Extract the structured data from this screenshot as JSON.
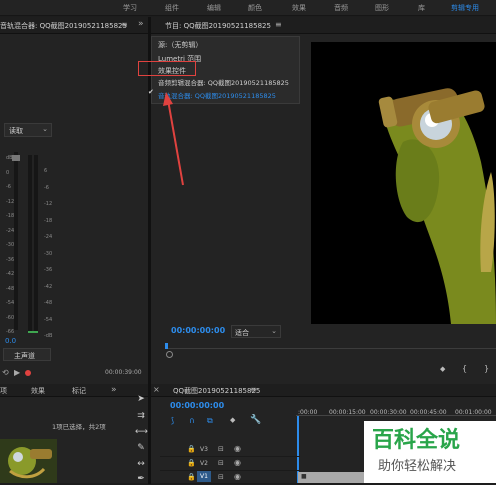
{
  "workspace_tabs": [
    "学习",
    "组件",
    "编辑",
    "颜色",
    "效果",
    "音频",
    "图形",
    "库",
    "剪辑专用"
  ],
  "active_workspace": "剪辑专用",
  "mixer": {
    "panel_title": "音轨混合器: QQ截图20190521185825",
    "read_mode": "读取",
    "db_scale": [
      "dB",
      "0",
      "-6",
      "-12",
      "-18",
      "-24",
      "-30",
      "-36",
      "-42",
      "-48",
      "-54",
      "-60",
      "-66"
    ],
    "db_scale_right": [
      "6",
      "-6",
      "-12",
      "-18",
      "-24",
      "-30",
      "-36",
      "-42",
      "-48",
      "-54",
      "-dB"
    ],
    "zero_value": "0.0",
    "master_label": "主声道",
    "timecode": "00:00:39:00"
  },
  "program": {
    "panel_title": "节目: QQ截图20190521185825",
    "timecode": "00:00:00:00",
    "fit_option": "适合"
  },
  "menu": {
    "items": [
      "源:（无剪辑）",
      "Lumetri 范围",
      "效果控件",
      "音频剪辑混合器: QQ截图20190521185825",
      "音轨混合器: QQ截图20190521185825"
    ],
    "checked_index": 4,
    "highlighted_index": 2
  },
  "project_panel": {
    "tabs": [
      "项",
      "效果",
      "标记"
    ],
    "selection_info": "1项已选择，共2项"
  },
  "timeline": {
    "title": "QQ截图20190521185825",
    "timecode": "00:00:00:00",
    "ruler": [
      ":00:00",
      "00:00:15:00",
      "00:00:30:00",
      "00:00:45:00",
      "00:01:00:00"
    ],
    "tracks": [
      "V3",
      "V2",
      "V1"
    ]
  },
  "watermark": {
    "title": "百科全说",
    "subtitle": "助你轻松解决"
  },
  "colors": {
    "accent": "#2d8ceb",
    "annotation_red": "#e0423f",
    "watermark_green": "#29a54a"
  }
}
